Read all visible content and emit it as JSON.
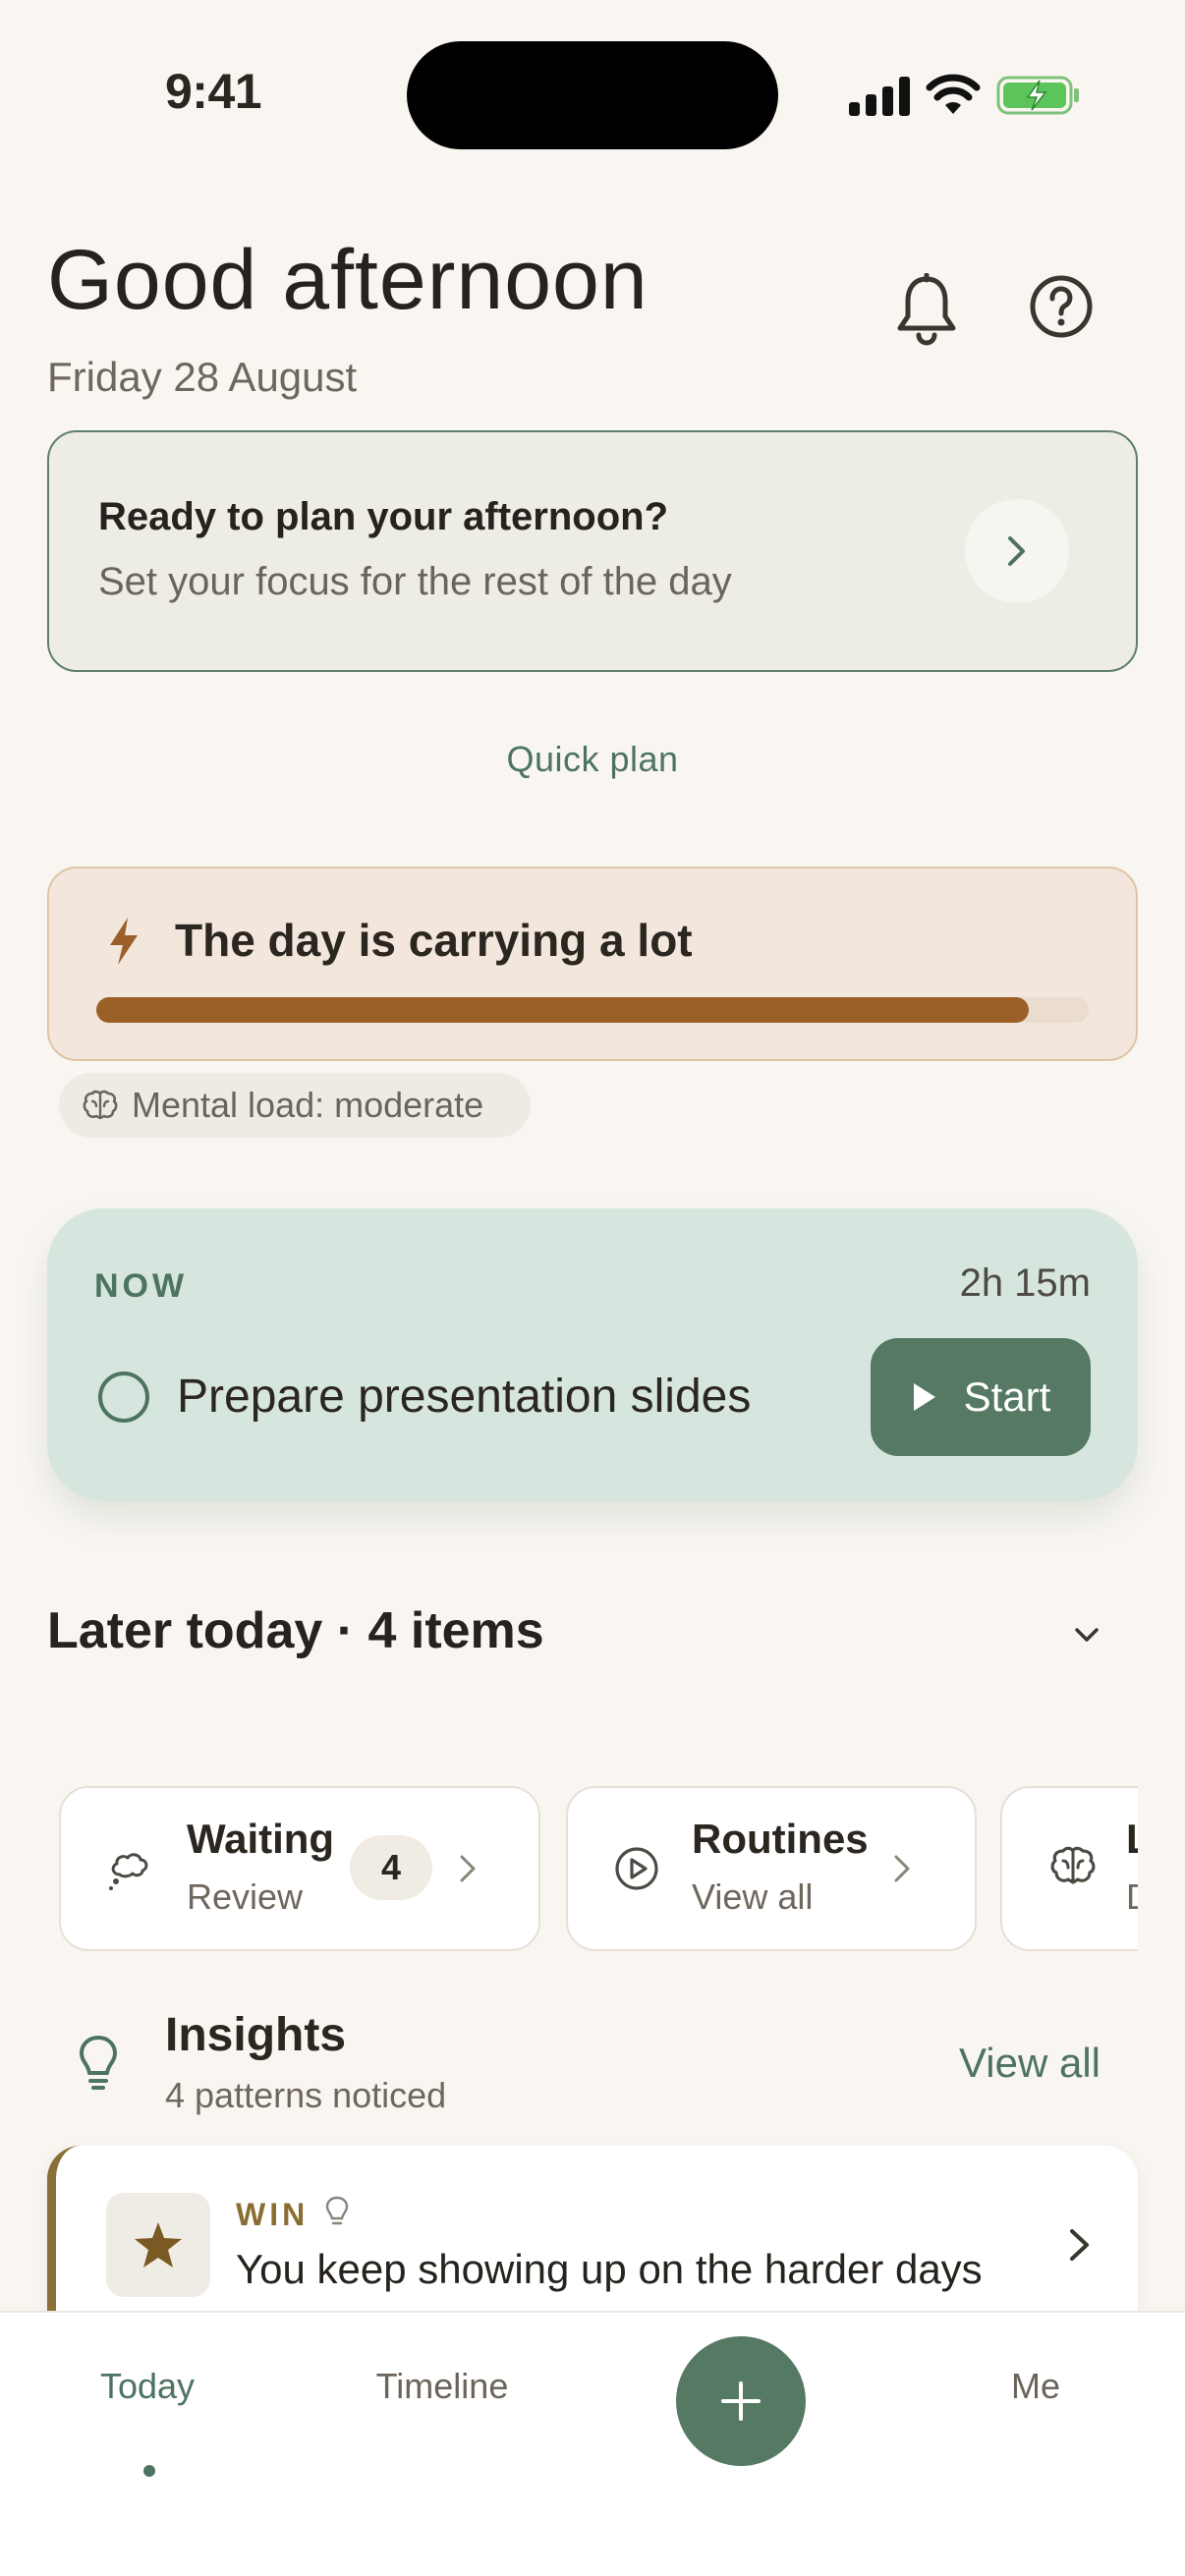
{
  "status_bar": {
    "time": "9:41"
  },
  "header": {
    "greeting": "Good afternoon",
    "date": "Friday 28 August",
    "icons": [
      "bell-icon",
      "help-icon"
    ]
  },
  "plan_card": {
    "title": "Ready to plan your afternoon?",
    "subtitle": "Set your focus for the rest of the day",
    "quick_plan": "Quick plan"
  },
  "load_card": {
    "title": "The day is carrying a lot",
    "level": 0.94,
    "mental_load": "Mental load: moderate"
  },
  "now_card": {
    "label": "NOW",
    "duration": "2h 15m",
    "task": "Prepare presentation slides",
    "start_label": "Start"
  },
  "later_today": {
    "label": "Later today · 4 items"
  },
  "chips": [
    {
      "title": "Waiting",
      "subtitle": "Review",
      "badge": "4",
      "icon": "thought-bubble-icon"
    },
    {
      "title": "Routines",
      "subtitle": "View all",
      "icon": "play-circle-icon"
    },
    {
      "title": "L",
      "subtitle": "D",
      "icon": "brain-icon"
    }
  ],
  "insights": {
    "title": "Insights",
    "subtitle": "4 patterns noticed",
    "view_all": "View all",
    "card": {
      "label": "WIN",
      "text": "You keep showing up on the harder days"
    }
  },
  "nav": {
    "today": "Today",
    "timeline": "Timeline",
    "me": "Me"
  },
  "colors": {
    "background": "#f9f6f1",
    "accent_green": "#567964",
    "load_fill": "#9b5f28",
    "win_accent": "#8a7036"
  }
}
